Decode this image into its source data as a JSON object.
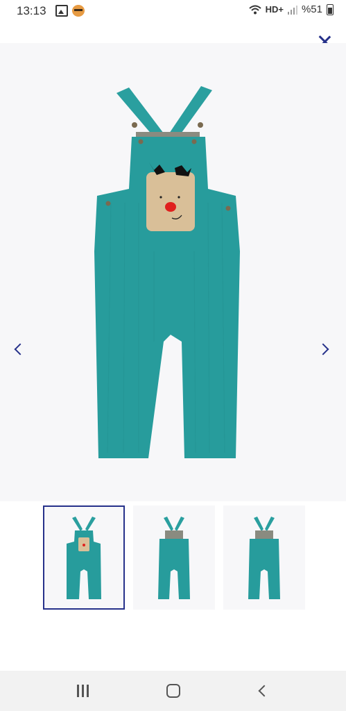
{
  "status_bar": {
    "time": "13:13",
    "network": "HD+",
    "battery": "%51",
    "icons": [
      "gallery-icon",
      "face-emoji-icon",
      "wifi-icon",
      "signal-icon",
      "battery-icon"
    ]
  },
  "viewer": {
    "close_icon": "close-icon",
    "prev_icon": "chevron-left-icon",
    "next_icon": "chevron-right-icon",
    "accent_color": "#26318a",
    "product_color": "#279c9c"
  },
  "thumbnails": [
    {
      "view": "front",
      "selected": true
    },
    {
      "view": "back",
      "selected": false
    },
    {
      "view": "back",
      "selected": false
    }
  ],
  "nav_bar": {
    "icons": [
      "recent-apps-icon",
      "home-icon",
      "back-icon"
    ]
  }
}
